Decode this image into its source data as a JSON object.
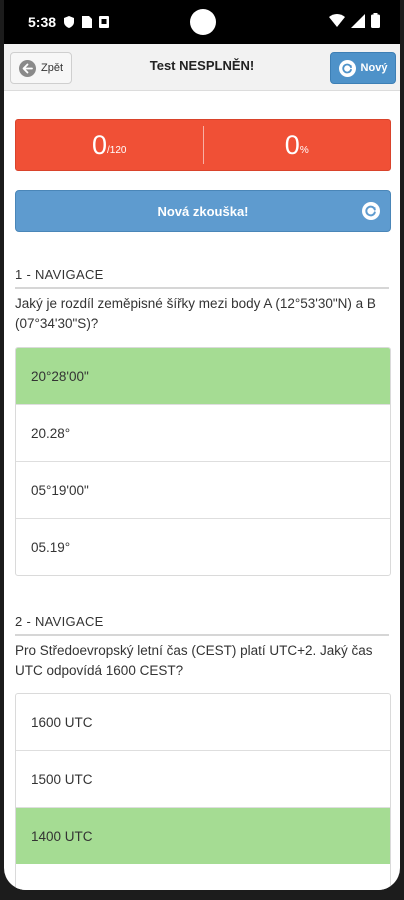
{
  "status": {
    "time": "5:38"
  },
  "toolbar": {
    "back_label": "Zpět",
    "title": "Test NESPLNĚN!",
    "new_label": "Nový"
  },
  "score": {
    "points": "0",
    "points_total": "/120",
    "percent": "0",
    "percent_unit": "%"
  },
  "new_test_label": "Nová zkouška!",
  "questions": [
    {
      "heading": "1 - NAVIGACE",
      "text": "Jaký je rozdíl zeměpisné šířky mezi body A (12°53'30\"N) a B (07°34'30\"S)?",
      "answers": [
        {
          "label": "20°28'00\"",
          "correct": true
        },
        {
          "label": "20.28°",
          "correct": false
        },
        {
          "label": "05°19'00\"",
          "correct": false
        },
        {
          "label": "05.19°",
          "correct": false
        }
      ]
    },
    {
      "heading": "2 - NAVIGACE",
      "text": "Pro Středoevropský letní čas (CEST) platí UTC+2. Jaký čas UTC odpovídá 1600 CEST?",
      "answers": [
        {
          "label": "1600 UTC",
          "correct": false
        },
        {
          "label": "1500 UTC",
          "correct": false
        },
        {
          "label": "1400 UTC",
          "correct": true
        }
      ]
    }
  ],
  "colors": {
    "wrong_bg": "#f05036",
    "primary": "#5e9bcf",
    "correct_bg": "#a5dc93"
  }
}
